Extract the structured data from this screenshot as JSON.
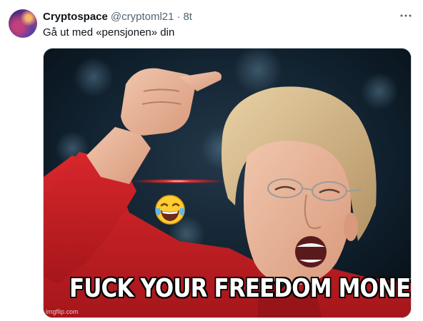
{
  "tweet": {
    "display_name": "Cryptospace",
    "handle": "@cryptoml21",
    "separator": "·",
    "time": "8t",
    "text": "Gå ut med «pensjonen» din",
    "more_icon": "more-horizontal-icon"
  },
  "media": {
    "caption": "FUCK YOUR FREEDOM MONEY!",
    "emoji": "😂",
    "watermark": "imgflip.com"
  },
  "colors": {
    "text_primary": "#0f1419",
    "text_secondary": "#536471",
    "border": "#cfd9de",
    "jacket_red": "#c81f24"
  }
}
